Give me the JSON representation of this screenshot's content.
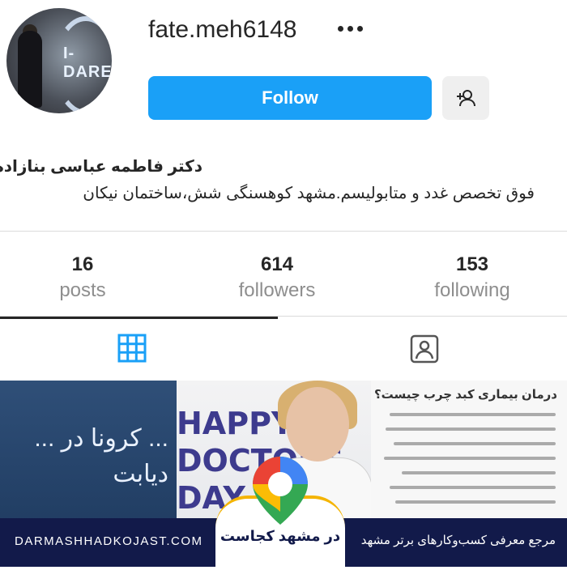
{
  "profile": {
    "username": "fate.meh6148",
    "follow_label": "Follow",
    "display_name": "دکتر فاطمه عباسی بنازاده",
    "bio": "فوق تخصص غدد و متابولیسم.مشهد کوهسنگی شش،ساختمان نیکان",
    "avatar_text": "I-DARE"
  },
  "stats": {
    "posts": {
      "count": "16",
      "label": "posts"
    },
    "followers": {
      "count": "614",
      "label": "followers"
    },
    "following": {
      "count": "153",
      "label": "following"
    }
  },
  "posts": {
    "post1_text": "... کرونا در ... دیابت",
    "post2_text": "HAPPY DOCTORS DAY",
    "post3_title": "درمان بیماری کبد چرب چیست؟"
  },
  "footer": {
    "left_text": "DARMASHHADKOJAST.COM",
    "right_text": "مرجع معرفی کسب‌وکارهای برتر مشهد",
    "brand_text": "در مشهد کجاست"
  },
  "colors": {
    "follow_blue": "#1aa0f7",
    "footer_navy": "#121a4a"
  },
  "icons": [
    "more-icon",
    "add-user-icon",
    "grid-icon",
    "tagged-icon",
    "location-pin-icon"
  ]
}
